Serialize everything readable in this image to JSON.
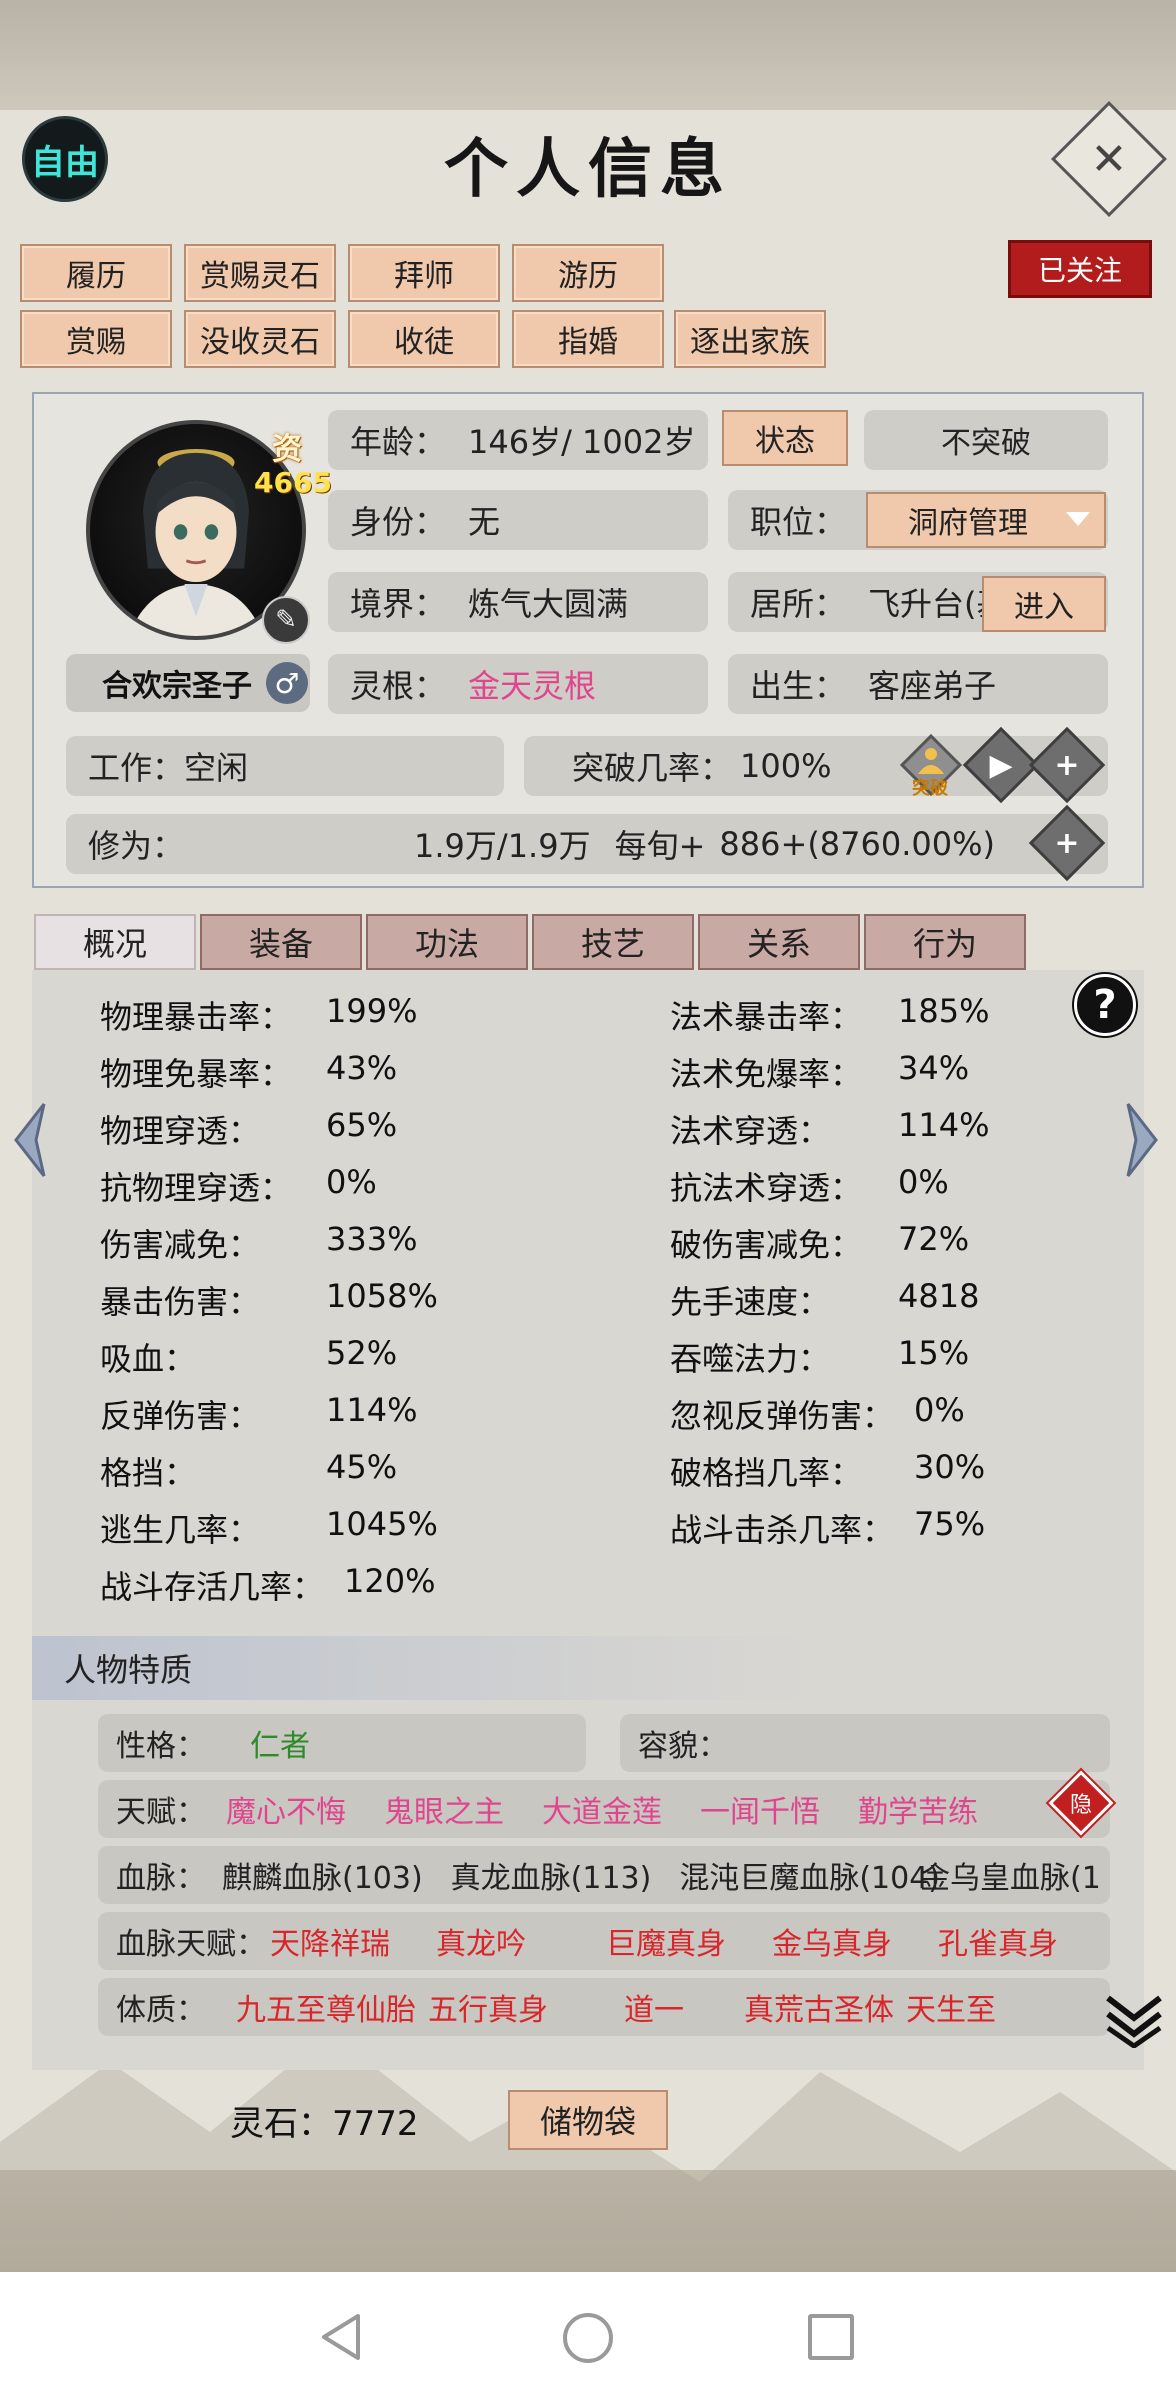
{
  "header": {
    "free_label": "自由",
    "title": "个人信息",
    "close_symbol": "✕"
  },
  "actions": {
    "row1": [
      "履历",
      "赏赐灵石",
      "拜师",
      "游历"
    ],
    "row2": [
      "赏赐",
      "没收灵石",
      "收徒",
      "指婚",
      "逐出家族"
    ],
    "follow_label": "已关注"
  },
  "profile": {
    "aptitude_label": "资",
    "aptitude_value": "4665",
    "name": "合欢宗圣子",
    "gender_symbol": "♂",
    "age_label": "年龄：",
    "age_value": "146岁/ 1002岁",
    "state_button": "状态",
    "breakthrough_state": "不突破",
    "identity_label": "身份：",
    "identity_value": "无",
    "position_label": "职位：",
    "position_value": "洞府管理",
    "realm_label": "境界：",
    "realm_value": "炼气大圆满",
    "residence_label": "居所：",
    "residence_value": "飞升台(基",
    "enter_button": "进入",
    "root_label": "灵根：",
    "root_value": "金天灵根",
    "birth_label": "出生：",
    "birth_value": "客座弟子",
    "work_label": "工作：",
    "work_value": "空闲",
    "break_rate_label": "突破几率：",
    "break_rate_value": "100%",
    "breakthrough_icon_label": "突破",
    "cultivation_label": "修为：",
    "cultivation_value": "1.9万/1.9万",
    "per_turn_label": "每旬+",
    "per_turn_value": "886+(8760.00%)"
  },
  "tabs": [
    "概况",
    "装备",
    "功法",
    "技艺",
    "关系",
    "行为"
  ],
  "stats_left": [
    {
      "label": "物理暴击率：",
      "value": "199%"
    },
    {
      "label": "物理免暴率：",
      "value": "43%"
    },
    {
      "label": "物理穿透：",
      "value": "65%"
    },
    {
      "label": "抗物理穿透：",
      "value": "0%"
    },
    {
      "label": "伤害减免：",
      "value": "333%"
    },
    {
      "label": "暴击伤害：",
      "value": "1058%"
    },
    {
      "label": "吸血：",
      "value": "52%"
    },
    {
      "label": "反弹伤害：",
      "value": "114%"
    },
    {
      "label": "格挡：",
      "value": "45%"
    },
    {
      "label": "逃生几率：",
      "value": "1045%"
    },
    {
      "label": "战斗存活几率：",
      "value": "120%"
    }
  ],
  "stats_right": [
    {
      "label": "法术暴击率：",
      "value": "185%"
    },
    {
      "label": "法术免爆率：",
      "value": "34%"
    },
    {
      "label": "法术穿透：",
      "value": "114%"
    },
    {
      "label": "抗法术穿透：",
      "value": "0%"
    },
    {
      "label": "破伤害减免：",
      "value": "72%"
    },
    {
      "label": "先手速度：",
      "value": "4818"
    },
    {
      "label": "吞噬法力：",
      "value": "15%"
    },
    {
      "label": "忽视反弹伤害：",
      "value": "0%"
    },
    {
      "label": "破格挡几率：",
      "value": "30%"
    },
    {
      "label": "战斗击杀几率：",
      "value": "75%"
    }
  ],
  "traits": {
    "section_title": "人物特质",
    "personality_label": "性格：",
    "personality_value": "仁者",
    "looks_label": "容貌：",
    "talent_label": "天赋：",
    "talents": [
      "魔心不悔",
      "鬼眼之主",
      "大道金莲",
      "一闻千悟",
      "勤学苦练"
    ],
    "hidden_badge": "隐",
    "bloodline_label": "血脉：",
    "bloodlines": [
      "麒麟血脉(103)",
      "真龙血脉(113)",
      "混沌巨魔血脉(104)",
      "金乌皇血脉(1"
    ],
    "bloodline_talent_label": "血脉天赋：",
    "bloodline_talents": [
      "天降祥瑞",
      "真龙吟",
      "巨魔真身",
      "金乌真身",
      "孔雀真身"
    ],
    "physique_label": "体质：",
    "physiques": [
      "九五至尊仙胎",
      "五行真身",
      "道一",
      "真荒古圣体",
      "天生至"
    ]
  },
  "footer": {
    "stones_label": "灵石：",
    "stones_value": "7772",
    "bag_button": "储物袋"
  }
}
